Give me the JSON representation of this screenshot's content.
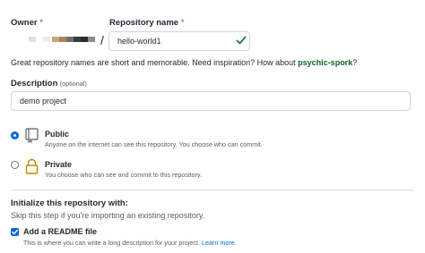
{
  "owner": {
    "label": "Owner",
    "required_mark": "*",
    "separator": "/"
  },
  "repository": {
    "label": "Repository name",
    "required_mark": "*",
    "value": "hello-world1",
    "valid_icon": "check-icon"
  },
  "name_hint": {
    "text": "Great repository names are short and memorable. Need inspiration? How about ",
    "suggestion": "psychic-spork",
    "suffix": "?"
  },
  "description": {
    "label": "Description",
    "optional": "(optional)",
    "value": "demo project"
  },
  "visibility": [
    {
      "title": "Public",
      "desc": "Anyone on the internet can see this repository. You choose who can commit.",
      "selected": true,
      "icon": "repo-icon"
    },
    {
      "title": "Private",
      "desc": "You choose who can see and commit to this repository.",
      "selected": false,
      "icon": "lock-icon"
    }
  ],
  "init": {
    "heading": "Initialize this repository with:",
    "subtext": "Skip this step if you're importing an existing repository.",
    "readme_label": "Add a README file",
    "readme_checked": true,
    "readme_desc": "This is where you can write a long description for your project.",
    "learn_more": "Learn more."
  },
  "colors": {
    "accent": "#0969da",
    "success": "#1a7f37",
    "danger": "#cf222e",
    "muted": "#57606a"
  }
}
